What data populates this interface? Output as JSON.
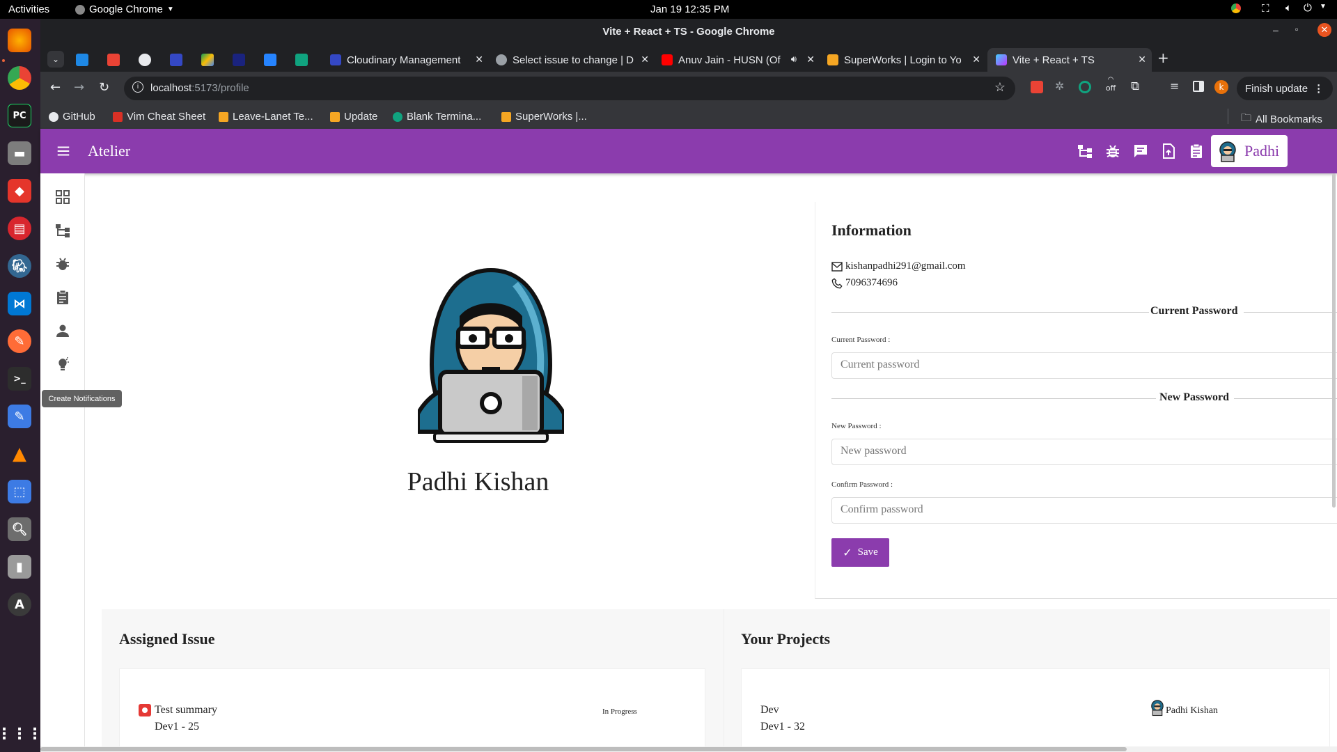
{
  "system": {
    "activities": "Activities",
    "app_menu": "Google Chrome",
    "clock": "Jan 19  12:35 PM"
  },
  "chrome": {
    "window_title": "Vite + React + TS - Google Chrome",
    "tabs": [
      {
        "label": "Cloudinary Management",
        "color": "#3448c5"
      },
      {
        "label": "Select issue to change | D",
        "color": "#9aa0a6"
      },
      {
        "label": "Anuv Jain - HUSN (Of",
        "color": "#ff0000"
      },
      {
        "label": "SuperWorks | Login to Yo",
        "color": "#f5a623"
      },
      {
        "label": "Vite + React + TS",
        "color": "#a855f7"
      }
    ],
    "url": {
      "host": "localhost",
      "path": ":5173/profile"
    },
    "extension_off_label": "off",
    "profile_initial": "k",
    "finish_update_label": "Finish update",
    "bookmarks": [
      {
        "label": "GitHub",
        "color": "#e8eaed"
      },
      {
        "label": "Vim Cheat Sheet",
        "color": "#d93025"
      },
      {
        "label": "Leave-Lanet Te...",
        "color": "#f5a623"
      },
      {
        "label": "Update",
        "color": "#f5a623"
      },
      {
        "label": "Blank Termina...",
        "color": "#10a37f"
      },
      {
        "label": "SuperWorks |...",
        "color": "#f5a623"
      }
    ],
    "all_bookmarks_label": "All Bookmarks"
  },
  "app": {
    "brand": "Atelier",
    "user_chip": "Padhi",
    "accent": "#8b3cad",
    "tooltip": "Create Notifications"
  },
  "profile": {
    "name": "Padhi Kishan",
    "info_title": "Information",
    "email": "kishanpadhi291@gmail.com",
    "phone": "7096374696",
    "current_password_heading": "Current Password",
    "current_password_label": "Current Password :",
    "current_password_placeholder": "Current password",
    "new_password_heading": "New Password",
    "new_password_label": "New Password :",
    "new_password_placeholder": "New password",
    "confirm_password_label": "Confirm Password :",
    "confirm_password_placeholder": "Confirm password",
    "save_label": "Save"
  },
  "assigned": {
    "title": "Assigned Issue",
    "items": [
      {
        "summary": "Test summary",
        "key": "Dev1 - 25",
        "status": "In Progress"
      }
    ]
  },
  "projects": {
    "title": "Your Projects",
    "items": [
      {
        "name": "Dev",
        "key": "Dev1 - 32",
        "lead": "Padhi Kishan"
      }
    ]
  }
}
